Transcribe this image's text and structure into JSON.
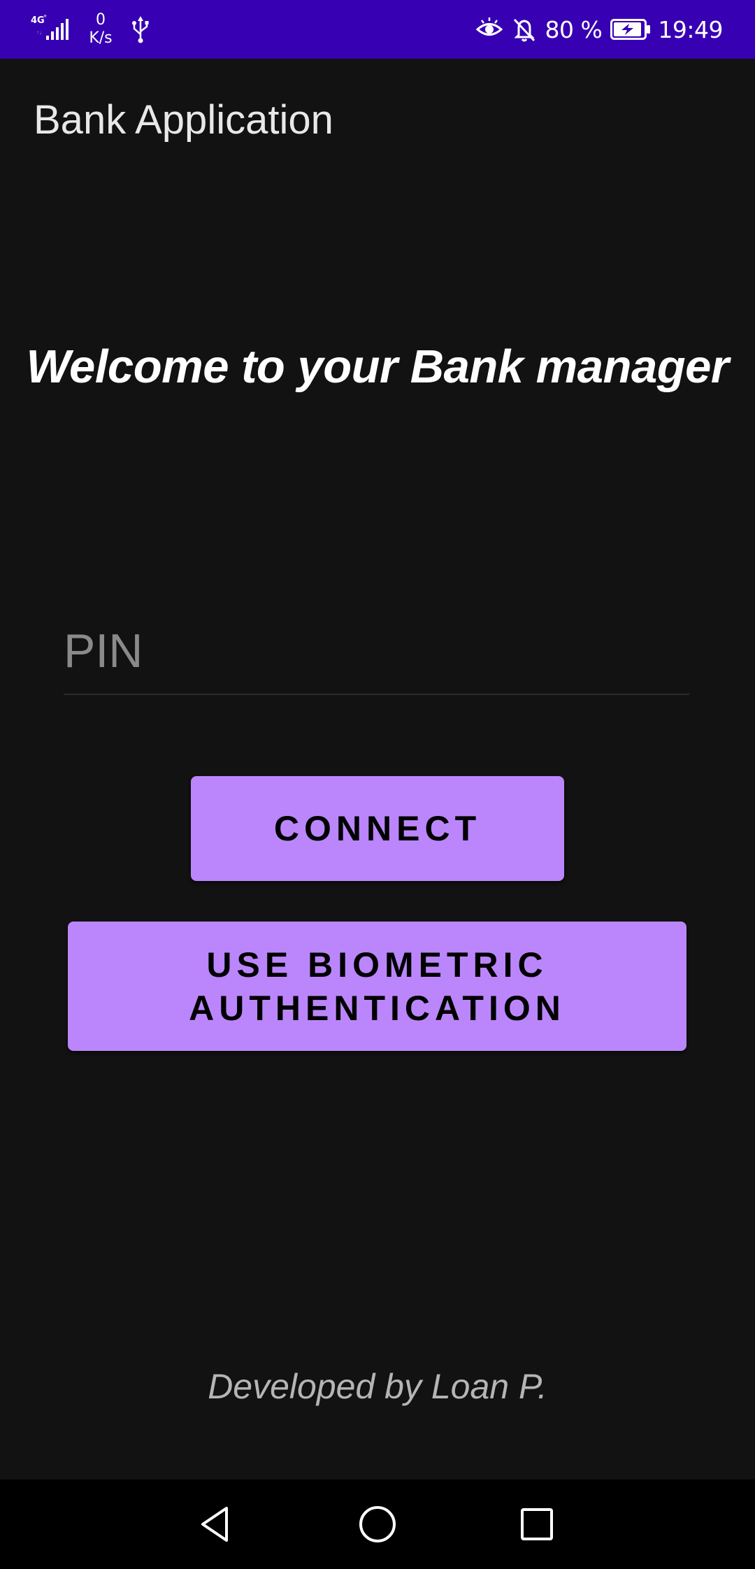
{
  "status_bar": {
    "network_type": "4G",
    "speed_value": "0",
    "speed_unit": "K/s",
    "battery_percent": "80 %",
    "time": "19:49",
    "background_color": "#3700b3",
    "icons": [
      "signal-icon",
      "usb-icon",
      "eye-comfort-icon",
      "notifications-off-icon",
      "battery-charging-icon"
    ]
  },
  "app_bar": {
    "title": "Bank Application"
  },
  "main": {
    "welcome_text": "Welcome to your Bank manager",
    "pin_placeholder": "PIN",
    "pin_value": "",
    "connect_label": "CONNECT",
    "biometric_label_line1": "USE BIOMETRIC",
    "biometric_label_line2": "AUTHENTICATION",
    "button_color": "#bb86fc"
  },
  "footer": {
    "credit": "Developed by Loan P."
  },
  "nav_bar": {
    "icons": [
      "back-icon",
      "home-icon",
      "recents-icon"
    ]
  },
  "theme": {
    "background": "#121212",
    "accent": "#bb86fc"
  }
}
